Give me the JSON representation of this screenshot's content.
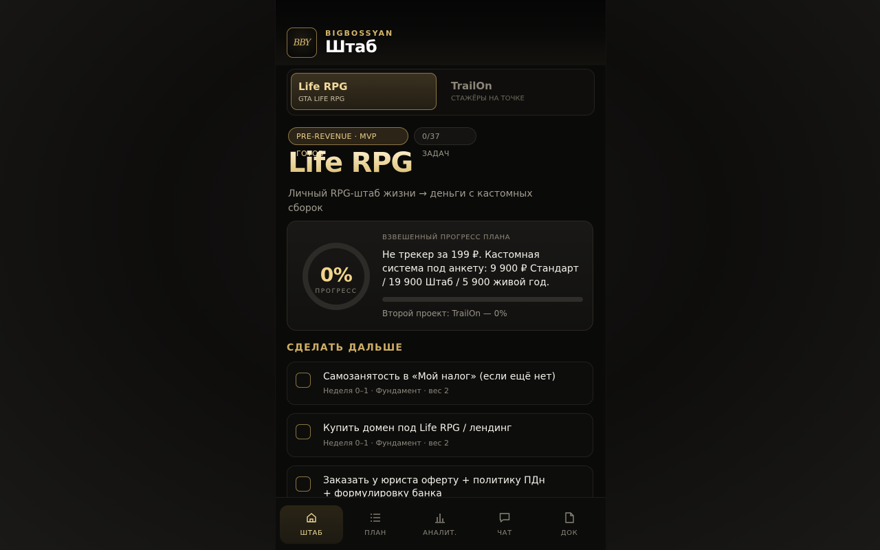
{
  "header": {
    "logo_text": "BBY",
    "brand": "BIGBOSSYAN",
    "title": "Штаб"
  },
  "projects": [
    {
      "name": "Life RPG",
      "subtitle": "GTA LIFE RPG",
      "active": true
    },
    {
      "name": "TrailOn",
      "subtitle": "СТАЖЁРЫ НА ТОЧКЕ",
      "active": false
    }
  ],
  "badges": {
    "stage": "PRE-REVENUE · MVP ГОТОВ",
    "tasks": "0/37 ЗАДАЧ"
  },
  "project": {
    "title": "Life RPG",
    "description": "Личный RPG-штаб жизни → деньги с кастомных сборок"
  },
  "progress_card": {
    "percent_label": "0%",
    "percent_caption": "ПРОГРЕСС",
    "progress_fraction": 0,
    "label": "ВЗВЕШЕННЫЙ ПРОГРЕСС ПЛАНА",
    "text": "Не трекер за 199 ₽. Кастомная система под анкету: 9 900 ₽ Стандарт / 19 900 Штаб / 5 900 живой год.",
    "second_project": "Второй проект: TrailOn — 0%"
  },
  "next_section": {
    "title": "СДЕЛАТЬ ДАЛЬШЕ",
    "tasks": [
      {
        "title": "Самозанятость в «Мой налог» (если ещё нет)",
        "meta": "Неделя 0–1 · Фундамент · вес 2"
      },
      {
        "title": "Купить домен под Life RPG / лендинг",
        "meta": "Неделя 0–1 · Фундамент · вес 2"
      },
      {
        "title": "Заказать у юриста оферту + политику ПДн + формулировку банка",
        "meta": ""
      }
    ]
  },
  "tabbar": [
    {
      "label": "ШТАБ",
      "icon": "home-icon",
      "active": true
    },
    {
      "label": "ПЛАН",
      "icon": "list-icon",
      "active": false
    },
    {
      "label": "АНАЛИТ.",
      "icon": "chart-icon",
      "active": false
    },
    {
      "label": "ЧАТ",
      "icon": "chat-icon",
      "active": false
    },
    {
      "label": "ДОК",
      "icon": "document-icon",
      "active": false
    }
  ],
  "colors": {
    "accent": "#d4b46a",
    "background": "#0a0a09"
  }
}
